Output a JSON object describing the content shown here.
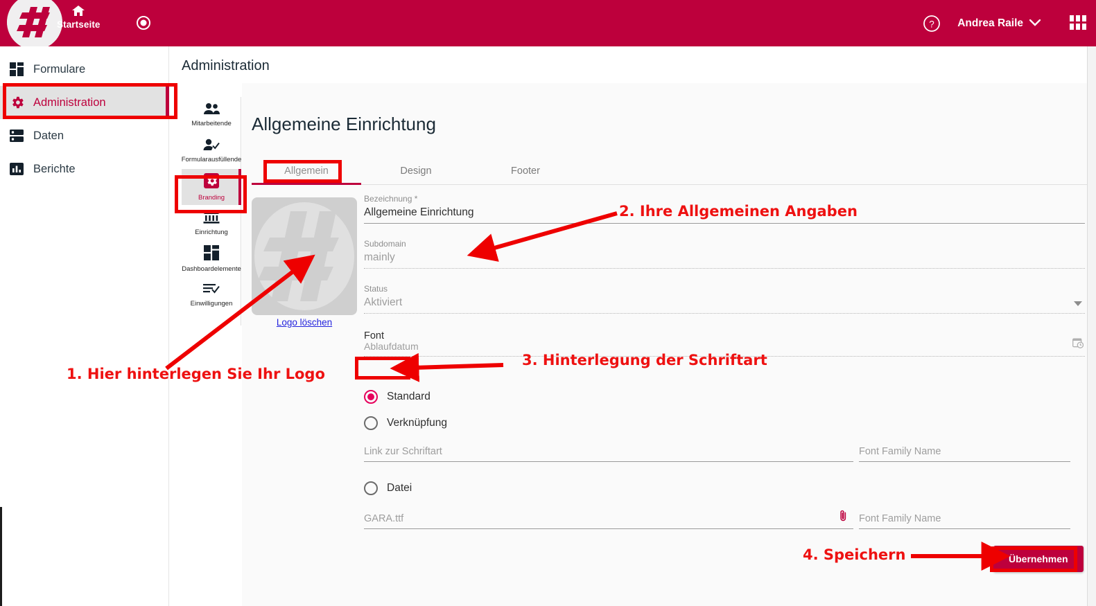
{
  "topbar": {
    "home_label": "Startseite",
    "home_icon": "home-icon",
    "record_icon": "record-dot-icon",
    "help_icon": "help-circle-icon",
    "user_name": "Andrea Raile",
    "user_chevron_icon": "chevron-down-icon",
    "apps_icon": "apps-grid-icon",
    "brand_icon": "hash-circle-logo",
    "bar_color": "#BD003C"
  },
  "sidebar": {
    "items": [
      {
        "label": "Formulare",
        "icon": "forms-grid-icon",
        "active": false
      },
      {
        "label": "Administration",
        "icon": "gear-icon",
        "active": true
      },
      {
        "label": "Daten",
        "icon": "database-icon",
        "active": false
      },
      {
        "label": "Berichte",
        "icon": "bar-chart-icon",
        "active": false
      }
    ]
  },
  "page": {
    "title": "Administration"
  },
  "iconnav": {
    "items": [
      {
        "label": "Mitarbeitende",
        "icon": "people-icon",
        "active": false
      },
      {
        "label": "Formularausfüllende",
        "icon": "person-check-icon",
        "active": false
      },
      {
        "label": "Branding",
        "icon": "gear-badge-icon",
        "active": true
      },
      {
        "label": "Einrichtung",
        "icon": "bank-icon",
        "active": false
      },
      {
        "label": "Dashboardelemente",
        "icon": "dashboard-grid-icon",
        "active": false
      },
      {
        "label": "Einwilligungen",
        "icon": "list-check-icon",
        "active": false
      }
    ]
  },
  "main": {
    "section_title": "Allgemeine Einrichtung",
    "tabs": [
      {
        "label": "Allgemein",
        "active": true
      },
      {
        "label": "Design",
        "active": false
      },
      {
        "label": "Footer",
        "active": false
      }
    ],
    "logo": {
      "delete_link": "Logo löschen",
      "placeholder_icon": "hash-logo-placeholder"
    },
    "fields": {
      "bezeichnung": {
        "label": "Bezeichnung *",
        "value": "Allgemeine Einrichtung",
        "disabled": false
      },
      "subdomain": {
        "label": "Subdomain",
        "value": "mainly",
        "disabled": true
      },
      "status": {
        "label": "Status",
        "value": "Aktiviert",
        "disabled": true,
        "caret_icon": "chevron-down-icon"
      },
      "ablaufdatum": {
        "label": "Ablaufdatum",
        "value": "",
        "disabled": true,
        "icon": "calendar-clock-icon"
      }
    },
    "font_group": {
      "legend": "Font",
      "options": [
        {
          "label": "Standard",
          "selected": true
        },
        {
          "label": "Verknüpfung",
          "selected": false
        },
        {
          "label": "Datei",
          "selected": false
        }
      ],
      "link_field": {
        "placeholder": "Link zur Schriftart",
        "value": ""
      },
      "link_family_field": {
        "placeholder": "Font Family Name",
        "value": ""
      },
      "file_field": {
        "placeholder": "GARA.ttf",
        "value": "",
        "icon": "paperclip-icon"
      },
      "file_family_field": {
        "placeholder": "Font Family Name",
        "value": ""
      }
    },
    "apply_button": "Übernehmen"
  },
  "annotations": {
    "color": "#ee1111",
    "items": [
      {
        "id": "anno-1",
        "text": "1. Hier hinterlegen Sie Ihr Logo"
      },
      {
        "id": "anno-2",
        "text": "2. Ihre Allgemeinen Angaben"
      },
      {
        "id": "anno-3",
        "text": "3. Hinterlegung der Schriftart"
      },
      {
        "id": "anno-4",
        "text": "4. Speichern"
      }
    ]
  }
}
